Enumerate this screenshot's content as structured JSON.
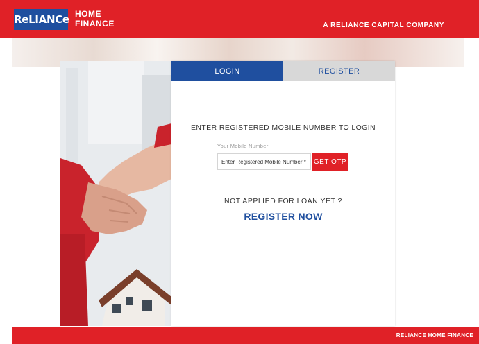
{
  "header": {
    "logo_text": "ReLIANCe",
    "logo_sub_line1": "HOME",
    "logo_sub_line2": "FINANCE",
    "tagline": "A RELIANCE CAPITAL COMPANY"
  },
  "tabs": [
    {
      "label": "LOGIN",
      "active": true
    },
    {
      "label": "REGISTER",
      "active": false
    }
  ],
  "login": {
    "prompt": "ENTER REGISTERED MOBILE NUMBER TO LOGIN",
    "field_label": "Your Mobile Number",
    "mobile_placeholder": "Enter Registered Mobile Number *",
    "otp_button": "GET OTP"
  },
  "signup": {
    "question": "NOT APPLIED FOR LOAN YET ?",
    "cta": "REGISTER NOW"
  },
  "footer": {
    "text": "RELIANCE HOME FINANCE"
  },
  "colors": {
    "brand_red": "#e02127",
    "brand_blue": "#1f4f9f",
    "tab_inactive": "#d8d8d8"
  }
}
